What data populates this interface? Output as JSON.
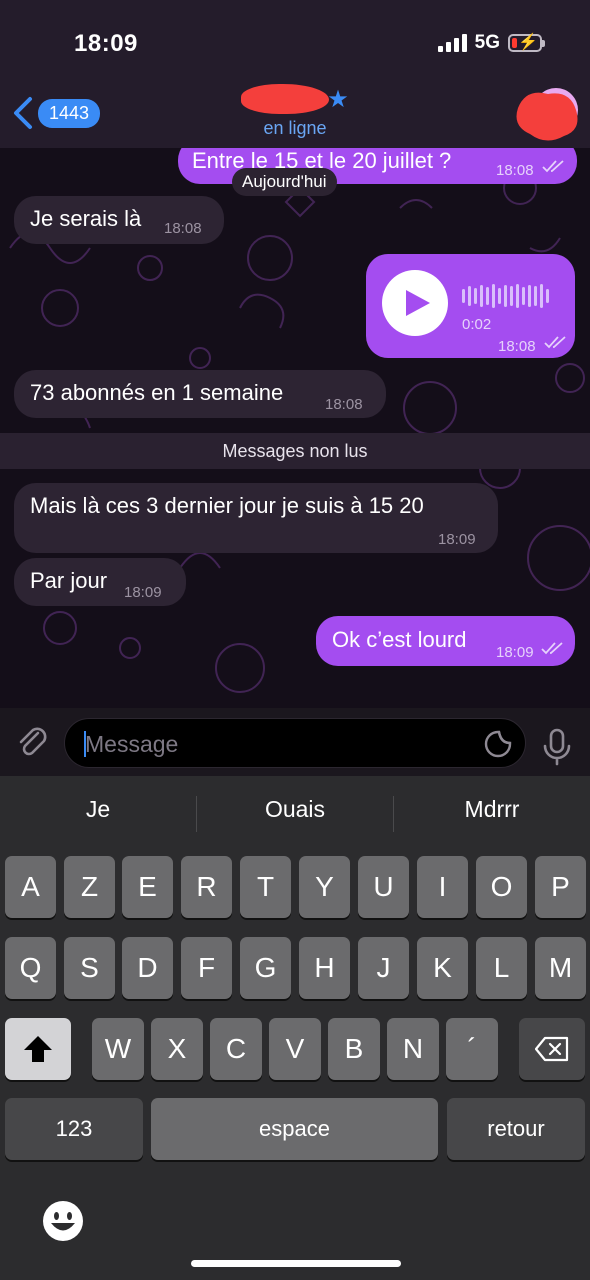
{
  "status": {
    "time": "18:09",
    "network": "5G"
  },
  "header": {
    "back_count": "1443",
    "subtitle": "en ligne"
  },
  "date_pill": "Aujourd'hui",
  "unread_label": "Messages non lus",
  "messages": [
    {
      "direction": "out",
      "text": "Entre le 15 et le 20 juillet ?",
      "time": "18:08"
    },
    {
      "direction": "in",
      "text": "Je serais là",
      "time": "18:08"
    },
    {
      "direction": "out",
      "type": "voice",
      "duration": "0:02",
      "time": "18:08"
    },
    {
      "direction": "in",
      "text": "73 abonnés en 1 semaine",
      "time": "18:08"
    },
    {
      "direction": "in",
      "text": "Mais là ces 3 dernier jour je suis à 15 20",
      "time": "18:09"
    },
    {
      "direction": "in",
      "text": "Par jour",
      "time": "18:09"
    },
    {
      "direction": "out",
      "text": "Ok c’est lourd",
      "time": "18:09"
    }
  ],
  "composer": {
    "placeholder": "Message"
  },
  "keyboard": {
    "suggestions": [
      "Je",
      "Ouais",
      "Mdrrr"
    ],
    "row1": [
      "A",
      "Z",
      "E",
      "R",
      "T",
      "Y",
      "U",
      "I",
      "O",
      "P"
    ],
    "row2": [
      "Q",
      "S",
      "D",
      "F",
      "G",
      "H",
      "J",
      "K",
      "L",
      "M"
    ],
    "row3": [
      "W",
      "X",
      "C",
      "V",
      "B",
      "N",
      "´"
    ],
    "numbers_label": "123",
    "space_label": "espace",
    "return_label": "retour"
  },
  "icons": {
    "back": "chevron-left-icon",
    "verified": "star-icon",
    "attach": "paperclip-icon",
    "sticker": "sticker-icon",
    "mic": "microphone-icon",
    "shift": "shift-arrow-icon",
    "delete": "backspace-icon",
    "emoji": "smiley-icon"
  },
  "colors": {
    "accent_blue": "#3a8bf5",
    "outgoing_bubble": "#a44df0",
    "incoming_bubble": "#2d2433",
    "battery_low": "#ff3b30"
  }
}
